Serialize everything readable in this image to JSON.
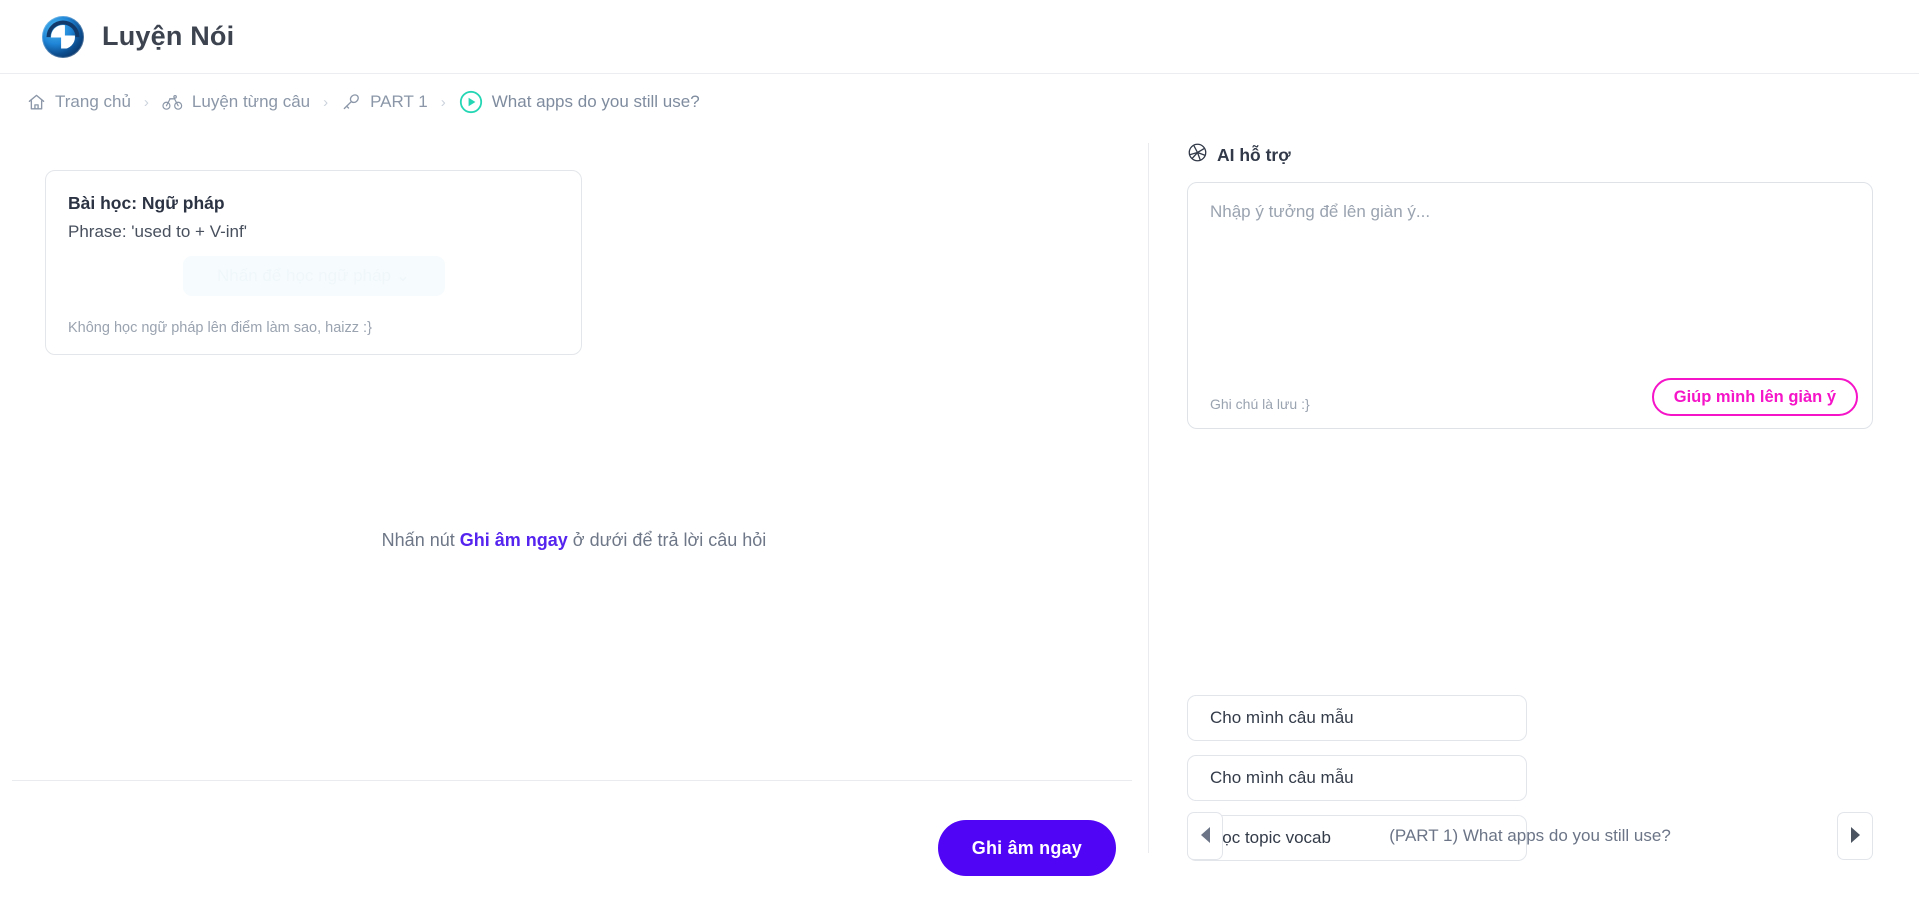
{
  "header": {
    "logo_icon": "swirl-s-logo",
    "title": "Luyện Nói"
  },
  "breadcrumb": {
    "separator": "›",
    "items": [
      {
        "label": "Trang chủ",
        "icon": "home-icon"
      },
      {
        "label": "Luyện từng câu",
        "icon": "bicycle-icon"
      },
      {
        "label": "PART 1",
        "icon": "microphone-icon"
      },
      {
        "label": "What apps do you still use?",
        "icon": "play-circle-icon"
      }
    ]
  },
  "grammar_card": {
    "title": "Bài học: Ngữ pháp",
    "phrase": "Phrase: 'used to + V-inf'",
    "cta_label": "Nhấn để học ngữ pháp ⌄",
    "note": "Không học ngữ pháp lên điểm làm sao, haizz :}"
  },
  "center_prompt": {
    "before": "Nhấn nút ",
    "highlight": "Ghi âm ngay",
    "after": " ở dưới để trả lời câu hỏi"
  },
  "record": {
    "label": "Ghi âm ngay"
  },
  "ai_panel": {
    "icon": "aperture-icon",
    "title": "AI hỗ trợ",
    "input_value": "",
    "input_placeholder": "Nhập ý tưởng để lên giàn ý...",
    "footnote": "Ghi chú là lưu :}",
    "action_label": "Giúp mình lên giàn ý"
  },
  "suggestions": [
    {
      "label": "Cho mình câu mẫu"
    },
    {
      "label": "Cho mình câu mẫu"
    },
    {
      "label": "Học topic vocab"
    }
  ],
  "question_nav": {
    "prev_icon": "chevron-left-icon",
    "next_icon": "chevron-right-icon",
    "label": "(PART 1) What apps do you still use?"
  },
  "colors": {
    "record_button": "#5105f5",
    "ai_action": "#f514c8",
    "play_icon": "#24d6b4",
    "highlight": "#5624ef"
  }
}
